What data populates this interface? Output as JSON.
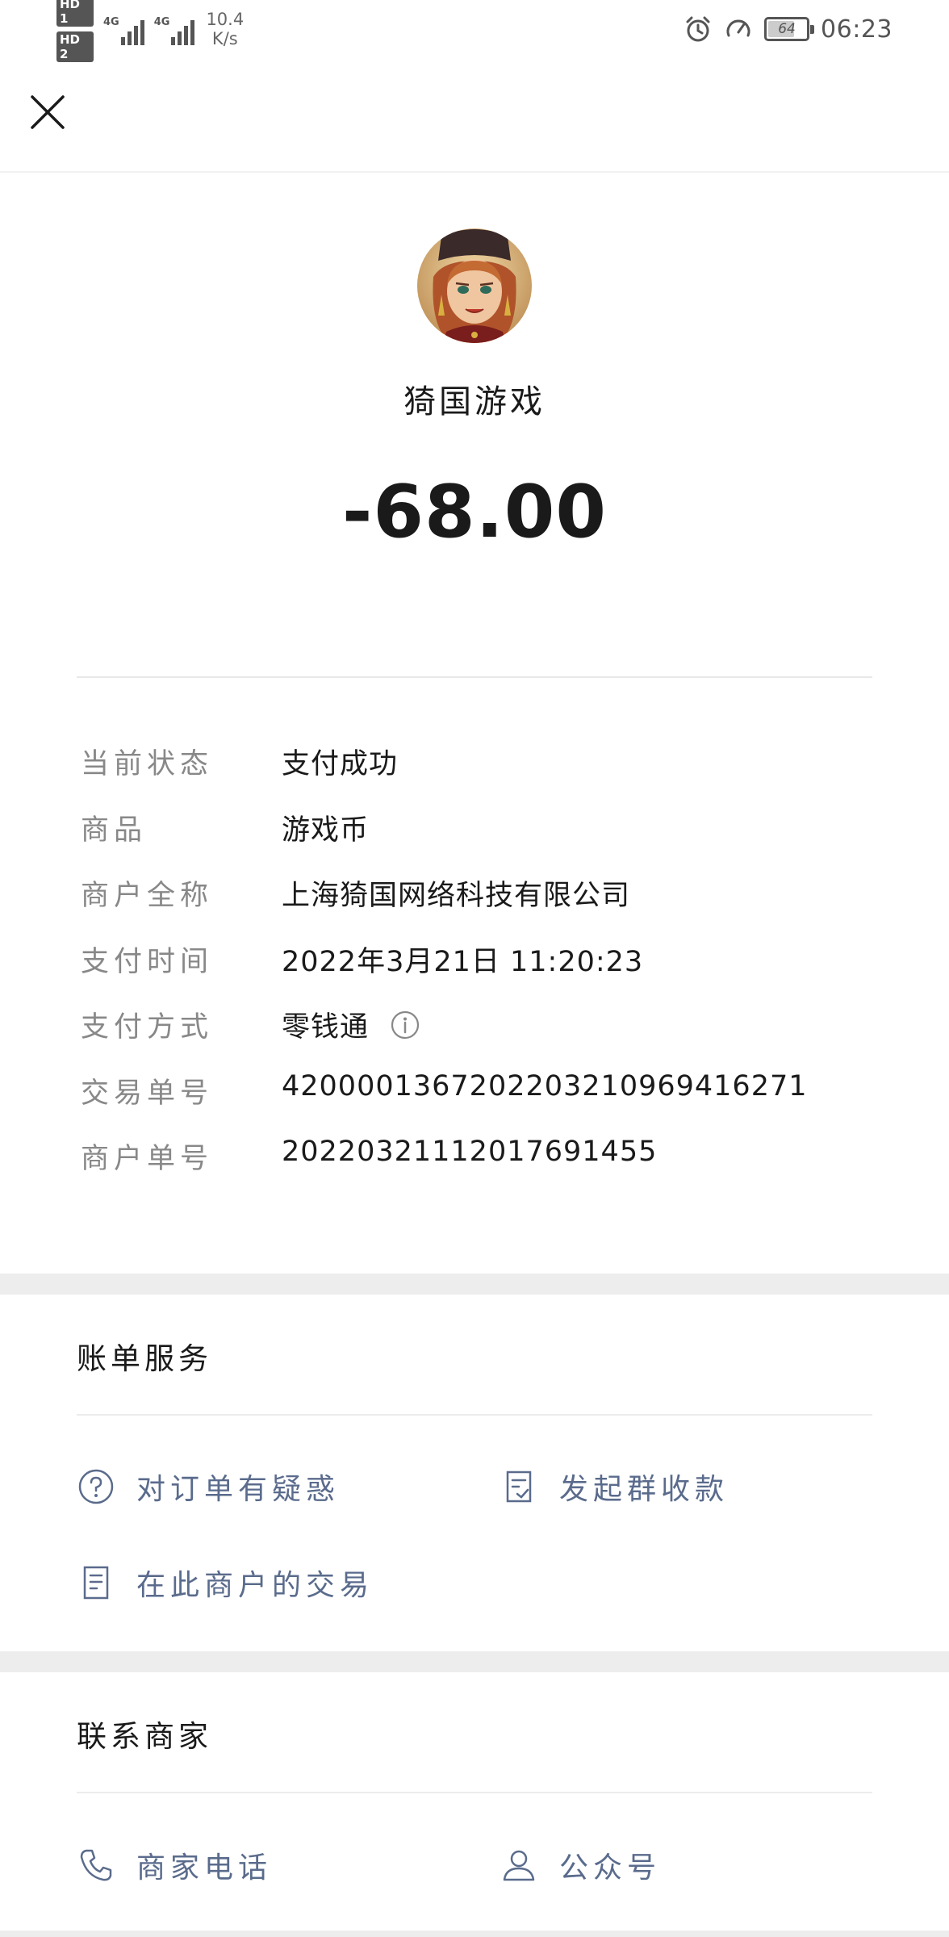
{
  "status_bar": {
    "hd1": "HD 1",
    "hd2": "HD 2",
    "sig1": "4G",
    "sig2": "4G",
    "net_speed_value": "10.4",
    "net_speed_unit": "K/s",
    "battery": "64",
    "time": "06:23"
  },
  "header": {
    "close_icon": "close-icon"
  },
  "merchant": {
    "name": "猗国游戏",
    "amount": "-68.00"
  },
  "details": [
    {
      "label": "当前状态",
      "value": "支付成功"
    },
    {
      "label": "商品",
      "value": "游戏币"
    },
    {
      "label": "商户全称",
      "value": "上海猗国网络科技有限公司"
    },
    {
      "label": "支付时间",
      "value": "2022年3月21日 11:20:23"
    },
    {
      "label": "支付方式",
      "value": "零钱通"
    },
    {
      "label": "交易单号",
      "value": "4200001367202203210969416271"
    },
    {
      "label": "商户单号",
      "value": "20220321112017691455"
    }
  ],
  "bill_service": {
    "title": "账单服务",
    "actions": [
      {
        "label": "对订单有疑惑",
        "icon": "question-circle-icon"
      },
      {
        "label": "发起群收款",
        "icon": "checklist-icon"
      },
      {
        "label": "在此商户的交易",
        "icon": "document-icon"
      }
    ]
  },
  "contact": {
    "title": "联系商家",
    "actions": [
      {
        "label": "商家电话",
        "icon": "phone-icon"
      },
      {
        "label": "公众号",
        "icon": "person-icon"
      }
    ]
  },
  "colors": {
    "action_text": "#5a6b8c",
    "label_text": "#888888",
    "separator": "#ededed"
  }
}
